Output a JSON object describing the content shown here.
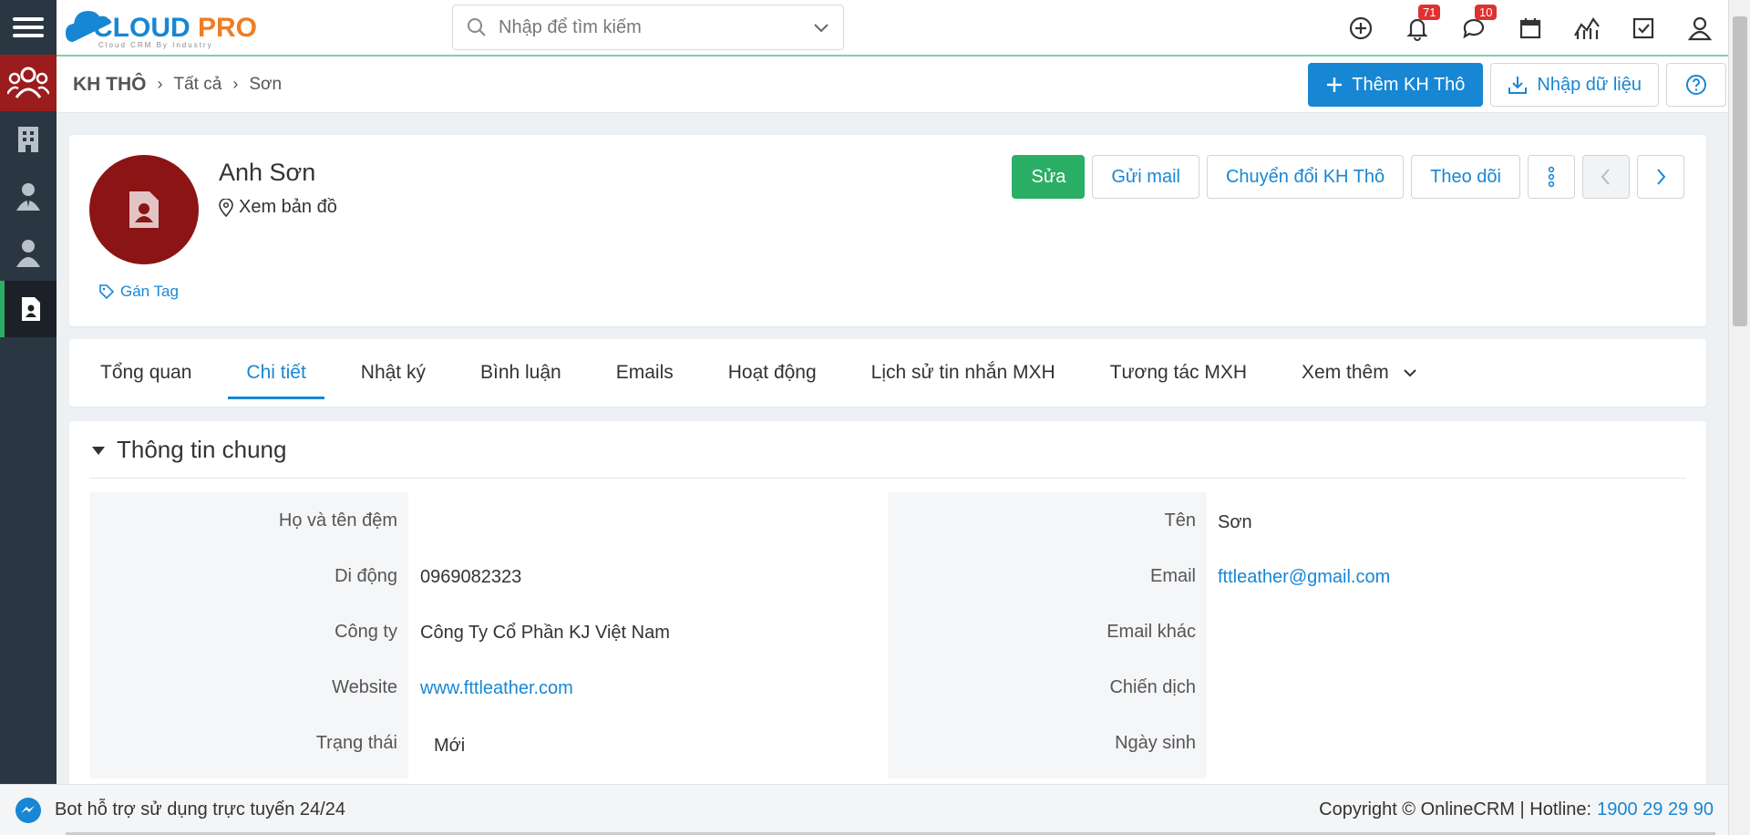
{
  "app": {
    "logo_text": "CLOUDPRO",
    "logo_tagline": "Cloud CRM By Industry"
  },
  "search": {
    "placeholder": "Nhập để tìm kiếm"
  },
  "header_icons": [
    {
      "icon": "plus-circle-icon"
    },
    {
      "icon": "bell-icon",
      "badge": "71"
    },
    {
      "icon": "chat-icon",
      "badge": "10"
    },
    {
      "icon": "calendar-icon"
    },
    {
      "icon": "chart-icon"
    },
    {
      "icon": "checkbox-icon"
    },
    {
      "icon": "user-icon"
    }
  ],
  "breadcrumb": {
    "root": "KH THÔ",
    "level1": "Tất cả",
    "level2": "Sơn"
  },
  "page_actions": {
    "add_label": "Thêm KH Thô",
    "import_label": "Nhập dữ liệu"
  },
  "profile": {
    "name": "Anh Sơn",
    "map_label": "Xem bản đồ",
    "tag_label": "Gán Tag",
    "actions": {
      "edit": "Sửa",
      "send_mail": "Gửi mail",
      "convert": "Chuyển đổi KH Thô",
      "follow": "Theo dõi"
    }
  },
  "tabs": [
    "Tổng quan",
    "Chi tiết",
    "Nhật ký",
    "Bình luận",
    "Emails",
    "Hoạt động",
    "Lịch sử tin nhắn MXH",
    "Tương tác MXH",
    "Xem thêm"
  ],
  "active_tab": "Chi tiết",
  "section": {
    "title": "Thông tin chung",
    "left_fields": [
      {
        "label": "Họ và tên đệm",
        "value": ""
      },
      {
        "label": "Di động",
        "value": "0969082323"
      },
      {
        "label": "Công ty",
        "value": "Công Ty Cổ Phần KJ Việt Nam"
      },
      {
        "label": "Website",
        "value": "www.fttleather.com"
      },
      {
        "label": "Trạng thái",
        "value": "Mới"
      }
    ],
    "right_fields": [
      {
        "label": "Tên",
        "value": "Sơn"
      },
      {
        "label": "Email",
        "value": "fttleather@gmail.com"
      },
      {
        "label": "Email khác",
        "value": ""
      },
      {
        "label": "Chiến dịch",
        "value": ""
      },
      {
        "label": "Ngày sinh",
        "value": ""
      }
    ]
  },
  "footer": {
    "bot_label": "Bot hỗ trợ sử dụng trực tuyến 24/24",
    "copyright": "Copyright © OnlineCRM | Hotline:",
    "hotline": "1900 29 29 90"
  },
  "colors": {
    "primary": "#1787d4",
    "success": "#2bae66",
    "sidebar": "#2b3643",
    "avatar": "#8b1414"
  }
}
